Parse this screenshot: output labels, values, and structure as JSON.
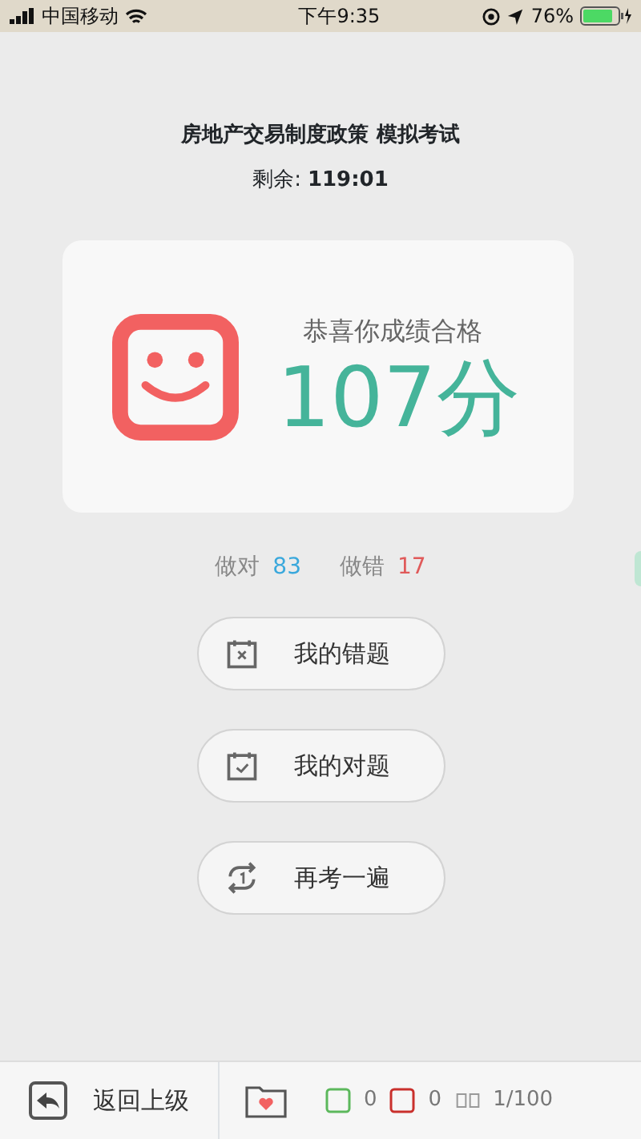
{
  "status_bar": {
    "carrier": "中国移动",
    "time": "下午9:35",
    "battery": "76%"
  },
  "header": {
    "title": "房地产交易制度政策 模拟考试",
    "remaining_label": "剩余:",
    "remaining_value": "119:01"
  },
  "result": {
    "message": "恭喜你成绩合格",
    "score": "107分"
  },
  "stats": [
    {
      "kind": "correct",
      "label": "做对",
      "value": "83"
    },
    {
      "kind": "wrong",
      "label": "做错",
      "value": "17"
    }
  ],
  "buttons": [
    {
      "kind": "wrong",
      "label": "我的错题"
    },
    {
      "kind": "correct",
      "label": "我的对题"
    },
    {
      "kind": "retry",
      "label": "再考一遍"
    }
  ],
  "bottom_bar": {
    "back_label": "返回上级",
    "counts": [
      {
        "kind": "correct",
        "value": "0"
      },
      {
        "kind": "wrong",
        "value": "0"
      },
      {
        "kind": "progress",
        "value": "1/100"
      }
    ]
  }
}
